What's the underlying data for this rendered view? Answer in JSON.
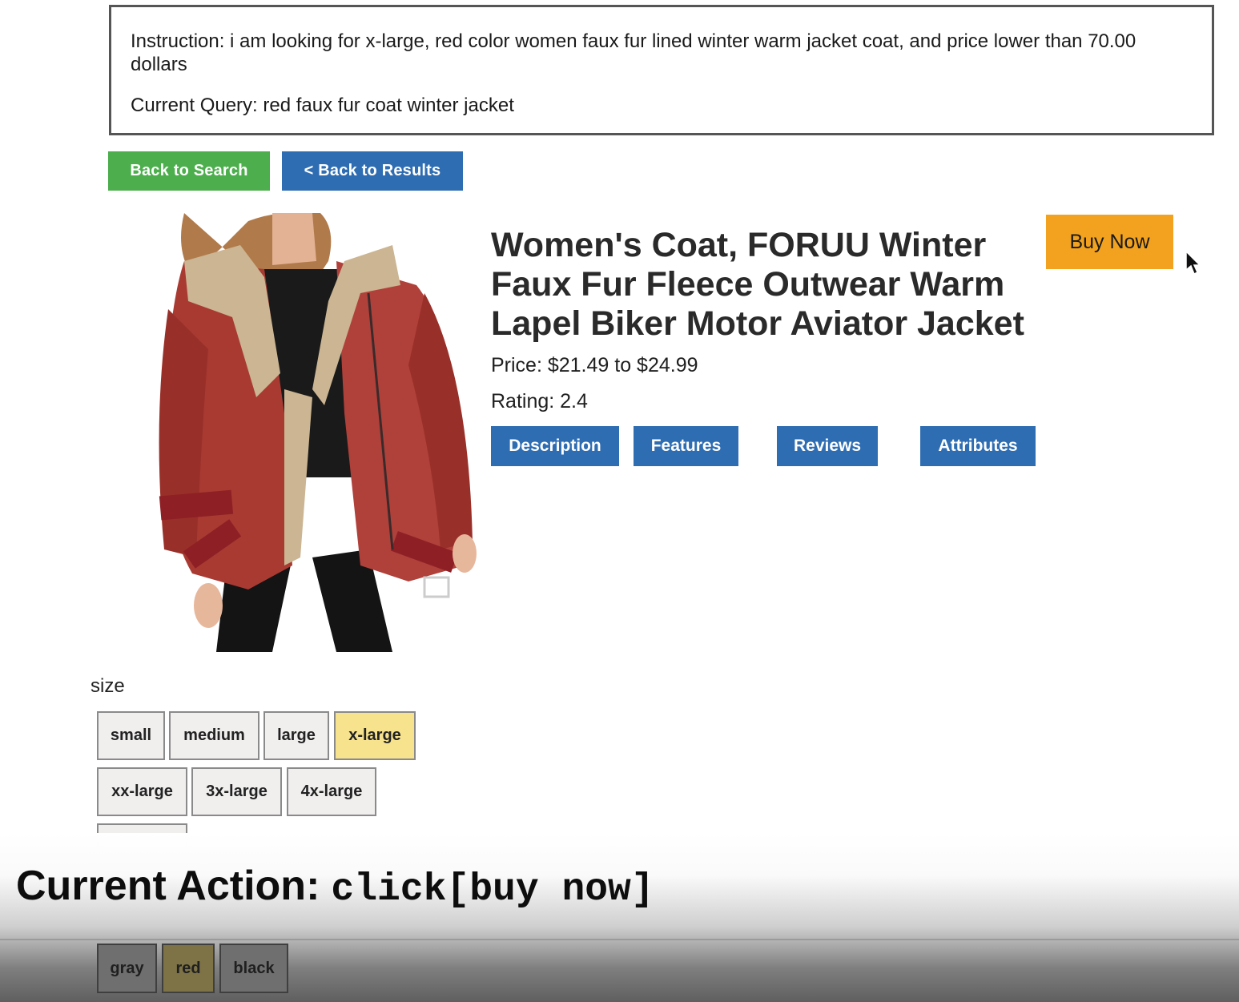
{
  "instruction": {
    "text": "Instruction: i am looking for x-large, red color women faux fur lined winter warm jacket coat, and price lower than 70.00 dollars",
    "query": "Current Query: red faux fur coat winter jacket"
  },
  "nav": {
    "back_to_search": "Back to Search",
    "back_to_results": "< Back to Results"
  },
  "product": {
    "image_icon": "red-jacket-product-image",
    "title": "Women's Coat, FORUU Winter Faux Fur Fleece Outwear Warm Lapel Biker Motor Aviator Jacket",
    "price": "Price: $21.49 to $24.99",
    "rating": "Rating: 2.4",
    "buy_now": "Buy Now"
  },
  "tabs": [
    "Description",
    "Features",
    "Reviews",
    "Attributes"
  ],
  "size": {
    "label": "size",
    "options": [
      "small",
      "medium",
      "large",
      "x-large",
      "xx-large",
      "3x-large",
      "4x-large"
    ],
    "selected": "x-large"
  },
  "color": {
    "options": [
      "gray",
      "red",
      "black"
    ],
    "selected": "red"
  },
  "action": {
    "label": "Current Action:",
    "code": "click[buy now]"
  },
  "colors": {
    "green_button": "#4cae4c",
    "blue_button": "#2f6db2",
    "buy_now": "#f2a21f",
    "selected_option": "#f7e38e"
  }
}
